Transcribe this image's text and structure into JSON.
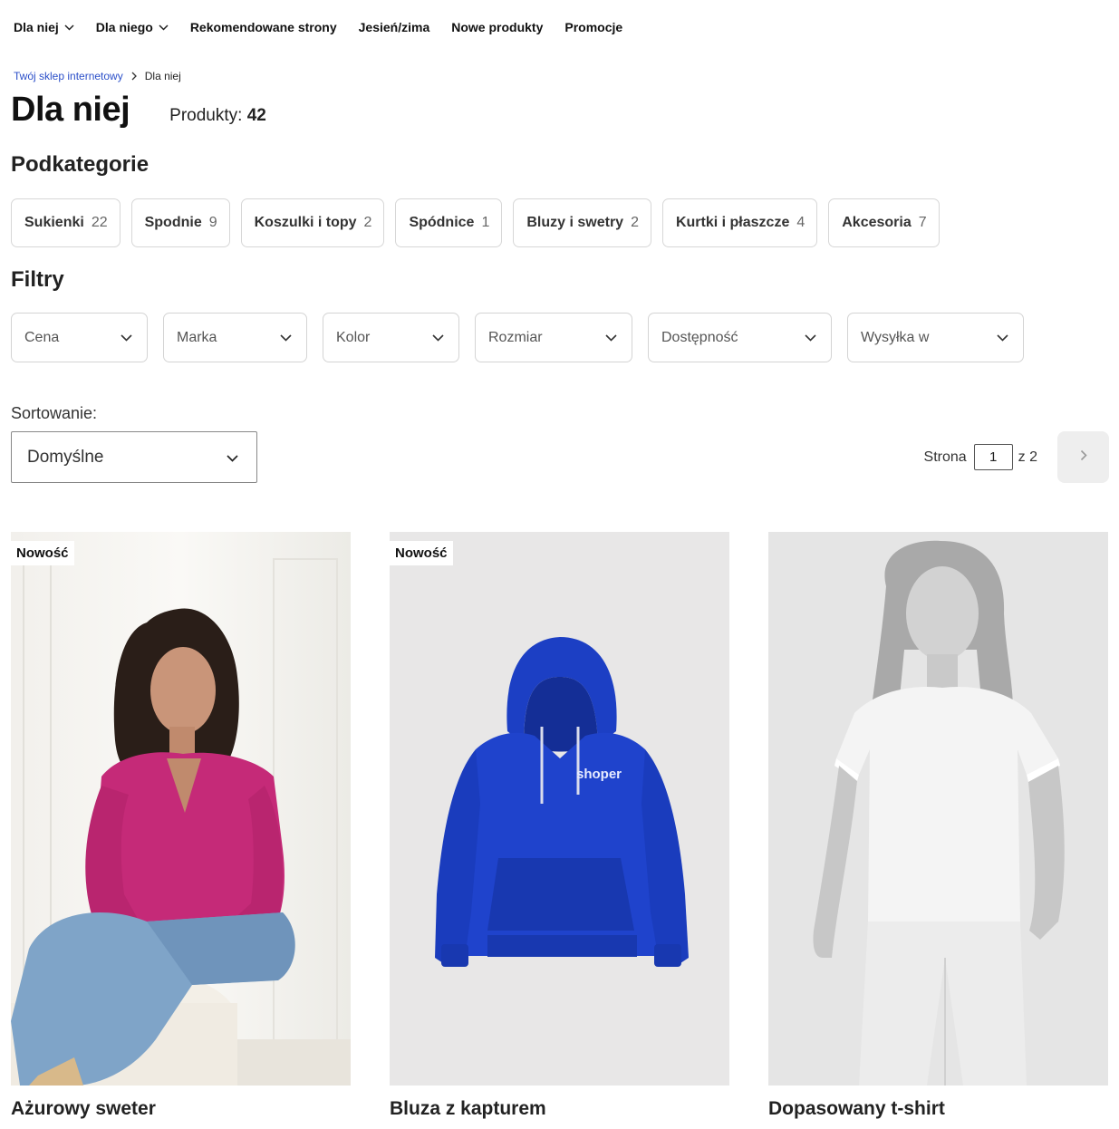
{
  "nav": {
    "items": [
      {
        "label": "Dla niej",
        "has_dropdown": true
      },
      {
        "label": "Dla niego",
        "has_dropdown": true
      },
      {
        "label": "Rekomendowane strony",
        "has_dropdown": false
      },
      {
        "label": "Jesień/zima",
        "has_dropdown": false
      },
      {
        "label": "Nowe produkty",
        "has_dropdown": false
      },
      {
        "label": "Promocje",
        "has_dropdown": false
      }
    ]
  },
  "breadcrumb": {
    "home": "Twój sklep internetowy",
    "current": "Dla niej"
  },
  "page": {
    "title": "Dla niej",
    "products_label": "Produkty:",
    "products_count": "42"
  },
  "subcategories": {
    "title": "Podkategorie",
    "items": [
      {
        "label": "Sukienki",
        "count": "22"
      },
      {
        "label": "Spodnie",
        "count": "9"
      },
      {
        "label": "Koszulki i topy",
        "count": "2"
      },
      {
        "label": "Spódnice",
        "count": "1"
      },
      {
        "label": "Bluzy i swetry",
        "count": "2"
      },
      {
        "label": "Kurtki i płaszcze",
        "count": "4"
      },
      {
        "label": "Akcesoria",
        "count": "7"
      }
    ]
  },
  "filters": {
    "title": "Filtry",
    "items": [
      {
        "label": "Cena"
      },
      {
        "label": "Marka"
      },
      {
        "label": "Kolor"
      },
      {
        "label": "Rozmiar"
      },
      {
        "label": "Dostępność"
      },
      {
        "label": "Wysyłka w"
      }
    ]
  },
  "sorting": {
    "label": "Sortowanie:",
    "selected": "Domyślne"
  },
  "pagination": {
    "label": "Strona",
    "current": "1",
    "total": "z 2"
  },
  "products": [
    {
      "name": "Ażurowy sweter",
      "badge": "Nowość"
    },
    {
      "name": "Bluza z kapturem",
      "badge": "Nowość",
      "print_text": "shoper"
    },
    {
      "name": "Dopasowany t-shirt",
      "badge": ""
    }
  ],
  "colors": {
    "link": "#2b4fc9",
    "hoodie": "#1c3fc4",
    "sweater": "#c52a78"
  }
}
